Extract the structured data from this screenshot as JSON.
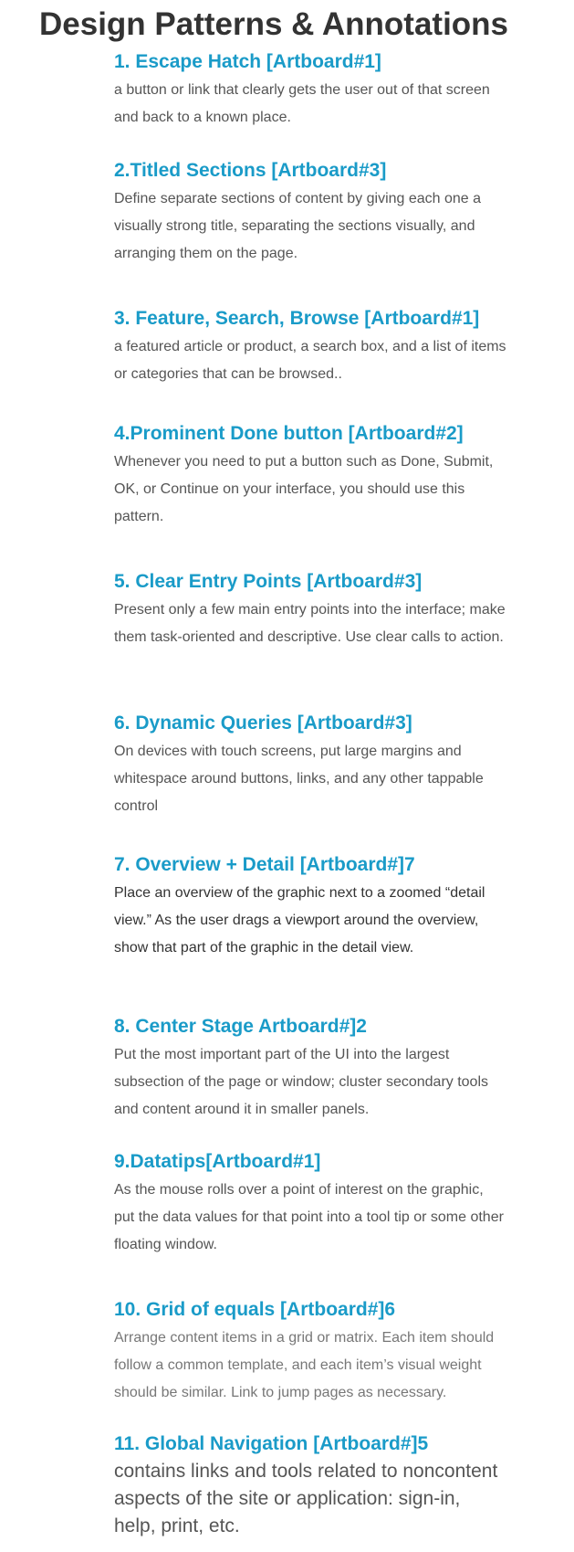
{
  "page": {
    "title": "Design Patterns & Annotations"
  },
  "sections": [
    {
      "heading": "1. Escape Hatch [Artboard#1]",
      "body": "a button or link that clearly gets the user out of that screen and back to a known place."
    },
    {
      "heading": "2.Titled Sections [Artboard#3]",
      "body": "Define separate sections of content by giving each one a visually strong title, separating the sections visually, and arranging them on the page."
    },
    {
      "heading": "3. Feature, Search, Browse [Artboard#1]",
      "body": "a featured article or product, a search box, and a list of items or categories that can be browsed.."
    },
    {
      "heading": "4.Prominent Done button [Artboard#2]",
      "body": "Whenever you need to put a button such as Done, Submit, OK, or Continue on your interface, you should use this pattern."
    },
    {
      "heading": "5. Clear Entry Points [Artboard#3]",
      "body": "Present only a few main entry points into the interface; make them task-oriented and descriptive. Use clear calls to action."
    },
    {
      "heading": "6. Dynamic Queries [Artboard#3]",
      "body": "On devices with touch screens, put large margins and whitespace around buttons, links, and any other tappable control"
    },
    {
      "heading": "7. Overview + Detail [Artboard#]7",
      "body": "Place an overview of the graphic next to a zoomed “detail view.” As the user drags a viewport around the overview, show that part of the graphic in the detail view."
    },
    {
      "heading": "8. Center Stage Artboard#]2",
      "body": "Put the most important part of the UI into the largest subsection of the page or window; cluster secondary tools and content around it in smaller panels."
    },
    {
      "heading": "9.Datatips[Artboard#1]",
      "body": "As the mouse rolls over a point of interest on the graphic, put the data values for that point into a tool tip or some other floating window."
    },
    {
      "heading": "10. Grid of equals [Artboard#]6",
      "body": "Arrange content items in a grid or matrix. Each item should follow a common template, and each item’s visual weight should be similar. Link to jump pages as necessary."
    },
    {
      "heading": "11. Global Navigation [Artboard#]5",
      "body": "contains links and tools related to noncontent aspects of the site or application: sign-in, help, print,  etc."
    }
  ]
}
